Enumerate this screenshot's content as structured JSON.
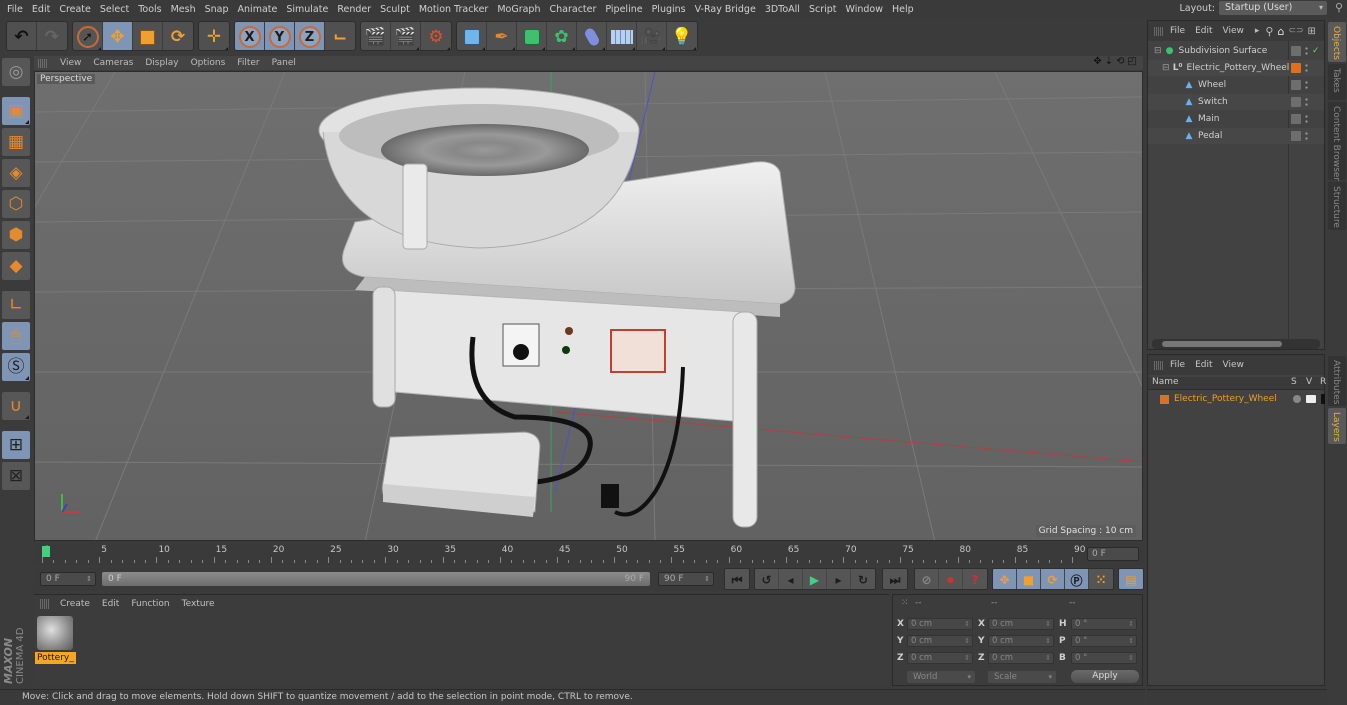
{
  "menubar": {
    "items": [
      "File",
      "Edit",
      "Create",
      "Select",
      "Tools",
      "Mesh",
      "Snap",
      "Animate",
      "Simulate",
      "Render",
      "Sculpt",
      "Motion Tracker",
      "MoGraph",
      "Character",
      "Pipeline",
      "Plugins",
      "V-Ray Bridge",
      "3DToAll",
      "Script",
      "Window",
      "Help"
    ],
    "layout_label": "Layout:",
    "layout_value": "Startup (User)"
  },
  "toolbar": {
    "groups": [
      [
        "undo-icon",
        "redo-icon"
      ],
      [
        "live-selection-icon",
        "move-icon",
        "scale-icon",
        "rotate-icon"
      ],
      [
        "recent-tool-icon"
      ],
      [
        "lock-x-icon",
        "lock-y-icon",
        "lock-z-icon",
        "coordinate-system-icon"
      ],
      [
        "render-view-icon",
        "render-picture-viewer-icon",
        "render-settings-icon"
      ],
      [
        "cube-icon",
        "pen-spline-icon",
        "subdivision-surface-icon",
        "cloner-icon",
        "deformer-icon",
        "floor-icon",
        "camera-icon",
        "light-icon"
      ]
    ],
    "axis_labels": [
      "X",
      "Y",
      "Z"
    ]
  },
  "left_tools": [
    "make-editable-icon",
    "model-mode-icon",
    "texture-mode-icon",
    "workplane-mode-icon",
    "points-mode-icon",
    "edges-mode-icon",
    "polygons-mode-icon",
    "axis-mode-icon",
    "tweak-mode-icon",
    "solo-icon",
    "snap-icon",
    "workplane-lock-icon",
    "planar-workplane-icon"
  ],
  "viewport": {
    "menu": [
      "View",
      "Cameras",
      "Display",
      "Options",
      "Filter",
      "Panel"
    ],
    "camera_label": "Perspective",
    "grid_spacing": "Grid Spacing : 10 cm",
    "nav_icons": [
      "pan-icon",
      "dolly-icon",
      "orbit-icon",
      "maximize-icon"
    ]
  },
  "timeline": {
    "ticks": [
      "0",
      "5",
      "10",
      "15",
      "20",
      "25",
      "30",
      "35",
      "40",
      "45",
      "50",
      "55",
      "60",
      "65",
      "70",
      "75",
      "80",
      "85",
      "90"
    ],
    "current_frame_field": "0 F",
    "start_field": "0 F",
    "range_start": "0 F",
    "range_end": "90 F",
    "end_field": "90 F",
    "playhead_frame": 0,
    "max_frame": 90
  },
  "transport": {
    "nav": [
      "go-to-start-icon",
      "previous-key-icon",
      "previous-frame-icon",
      "play-icon",
      "next-frame-icon",
      "next-key-icon",
      "go-to-end-icon"
    ],
    "record": [
      "autokey-icon",
      "record-icon",
      "keyframe-help-icon"
    ],
    "key_tracks": [
      "key-position-icon",
      "key-scale-icon",
      "key-rotation-icon",
      "key-param-icon",
      "key-pla-icon"
    ],
    "timeline_icon": "timeline-icon"
  },
  "materials": {
    "menu": [
      "Create",
      "Edit",
      "Function",
      "Texture"
    ],
    "items": [
      {
        "name": "Pottery_"
      }
    ]
  },
  "brand": {
    "line1": "MAXON",
    "line2": "CINEMA 4D"
  },
  "coordinates": {
    "headers": [
      "--",
      "--",
      "--"
    ],
    "position": [
      {
        "axis": "X",
        "value": "0 cm"
      },
      {
        "axis": "Y",
        "value": "0 cm"
      },
      {
        "axis": "Z",
        "value": "0 cm"
      }
    ],
    "size": [
      {
        "axis": "X",
        "value": "0 cm"
      },
      {
        "axis": "Y",
        "value": "0 cm"
      },
      {
        "axis": "Z",
        "value": "0 cm"
      }
    ],
    "rotation": [
      {
        "axis": "H",
        "value": "0 °"
      },
      {
        "axis": "P",
        "value": "0 °"
      },
      {
        "axis": "B",
        "value": "0 °"
      }
    ],
    "space_dropdown": "World",
    "mode_dropdown": "Scale",
    "apply_label": "Apply"
  },
  "status": {
    "text": "Move: Click and drag to move elements. Hold down SHIFT to quantize movement / add to the selection in point mode, CTRL to remove."
  },
  "object_manager": {
    "menu": [
      "File",
      "Edit",
      "View"
    ],
    "objects": [
      {
        "name": "Subdivision Surface",
        "icon": "subdivision-icon",
        "depth": 0,
        "check": "✓"
      },
      {
        "name": "Electric_Pottery_Wheel",
        "icon": "null-icon",
        "depth": 1,
        "layer_color": "#e07020"
      },
      {
        "name": "Wheel",
        "icon": "polygon-icon",
        "depth": 2
      },
      {
        "name": "Switch",
        "icon": "polygon-icon",
        "depth": 2
      },
      {
        "name": "Main",
        "icon": "polygon-icon",
        "depth": 2
      },
      {
        "name": "Pedal",
        "icon": "polygon-icon",
        "depth": 2
      }
    ]
  },
  "layer_manager": {
    "menu": [
      "File",
      "Edit",
      "View"
    ],
    "columns": [
      "Name",
      "S",
      "V",
      "R"
    ],
    "layers": [
      {
        "name": "Electric_Pottery_Wheel",
        "color": "#e07020"
      }
    ]
  },
  "side_tabs_top": [
    {
      "label": "Objects",
      "active": true
    },
    {
      "label": "Takes",
      "active": false
    },
    {
      "label": "Content Browser",
      "active": false
    },
    {
      "label": "Structure",
      "active": false
    }
  ],
  "side_tabs_bottom": [
    {
      "label": "Attributes",
      "active": false
    },
    {
      "label": "Layers",
      "active": true
    }
  ],
  "colors": {
    "accent_blue": "#7e95b5",
    "accent_orange": "#e68a2e",
    "layer_text": "#f0a020",
    "playhead": "#3fd27f"
  }
}
